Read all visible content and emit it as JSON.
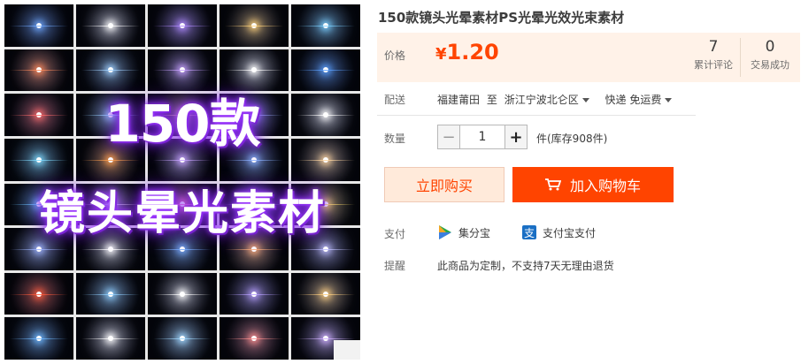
{
  "gallery": {
    "overlay_line1": "150款",
    "overlay_line2": "镜头晕光素材",
    "flare_colors": [
      "#6fa8ff",
      "#ffffff",
      "#b089ff",
      "#ffd27a",
      "#7ad0ff",
      "#ff8a5a",
      "#9fd1ff",
      "#c7a0ff",
      "#ffffff",
      "#5aa0ff",
      "#ff6a6a",
      "#9ad8ff",
      "#ffe38a",
      "#a0b8ff",
      "#ffffff",
      "#7fdcff",
      "#ff9f4a",
      "#c9a6ff",
      "#8ab4ff",
      "#ffd6a0",
      "#6ac8ff",
      "#ffffff",
      "#ff7acb",
      "#a8e0ff",
      "#ffe066",
      "#9fb6ff",
      "#ffffff",
      "#7ab0ff",
      "#ffb07a",
      "#c0c0ff",
      "#ff5a3a",
      "#8fd0ff",
      "#ffffff",
      "#b8a0ff",
      "#ffd080",
      "#6fb8ff",
      "#ffffff",
      "#a0d8ff",
      "#ff8f8f",
      "#d0b0ff"
    ]
  },
  "product": {
    "title": "150款镜头光晕素材PS光晕光效光束素材"
  },
  "price": {
    "label": "价格",
    "currency": "¥",
    "amount": "1.20",
    "reviews_count": "7",
    "reviews_label": "累计评论",
    "sales_count": "0",
    "sales_label": "交易成功"
  },
  "shipping": {
    "label": "配送",
    "origin": "福建莆田",
    "to": "至",
    "destination": "浙江宁波北仑区",
    "method": "快递 免运费"
  },
  "quantity": {
    "label": "数量",
    "value": "1",
    "minus": "−",
    "plus": "+",
    "stock": "件(库存908件)"
  },
  "actions": {
    "buy_now": "立即购买",
    "add_to_cart": "加入购物车"
  },
  "payment": {
    "label": "支付",
    "methods": [
      "集分宝",
      "支付宝支付"
    ]
  },
  "notice": {
    "label": "提醒",
    "text": "此商品为定制，不支持7天无理由退货"
  },
  "colors": {
    "accent": "#ff4400",
    "price_bg": "#fff2e8"
  }
}
